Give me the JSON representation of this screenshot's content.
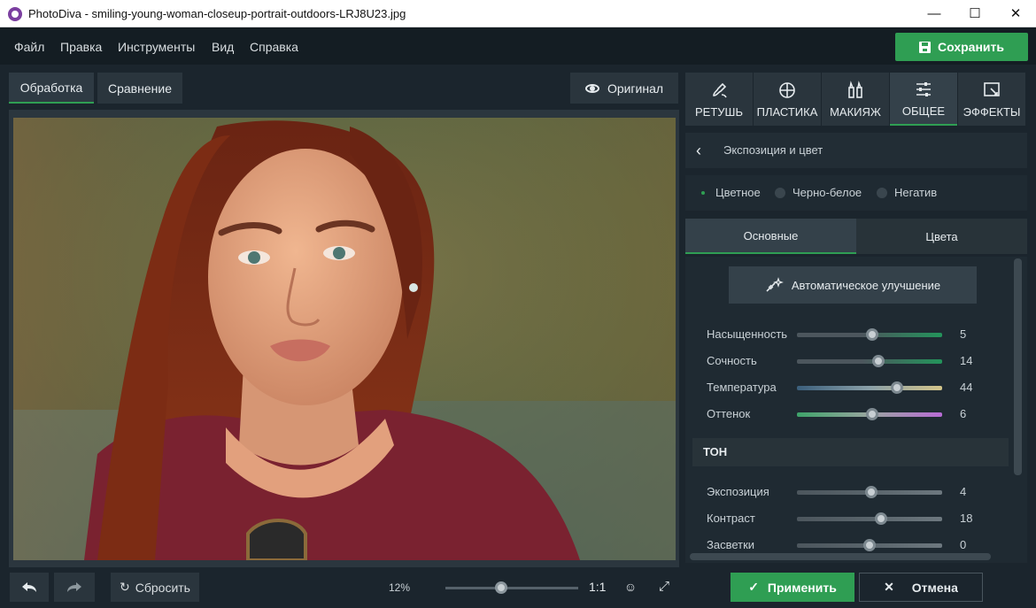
{
  "window": {
    "title": "PhotoDiva - smiling-young-woman-closeup-portrait-outdoors-LRJ8U23.jpg",
    "minimize": "—",
    "maximize": "☐",
    "close": "✕"
  },
  "menu": {
    "items": [
      "Файл",
      "Правка",
      "Инструменты",
      "Вид",
      "Справка"
    ],
    "save_label": "Сохранить"
  },
  "view_tabs": {
    "process": "Обработка",
    "compare": "Сравнение",
    "original": "Оригинал"
  },
  "tool_tabs": [
    {
      "label": "РЕТУШЬ",
      "icon": "retouch-brush-icon"
    },
    {
      "label": "ПЛАСТИКА",
      "icon": "crosshair-icon"
    },
    {
      "label": "МАКИЯЖ",
      "icon": "makeup-icon"
    },
    {
      "label": "ОБЩЕЕ",
      "icon": "sliders-icon",
      "active": true
    },
    {
      "label": "ЭФФЕКТЫ",
      "icon": "effects-icon"
    }
  ],
  "section": {
    "title": "Экспозиция и цвет"
  },
  "color_modes": {
    "color": "Цветное",
    "bw": "Черно-белое",
    "negative": "Негатив",
    "selected": "Цветное"
  },
  "sub_tabs": {
    "basic": "Основные",
    "colors": "Цвета"
  },
  "auto_enhance_label": "Автоматическое улучшение",
  "color_sliders": [
    {
      "label": "Насыщенность",
      "value": "5",
      "position": 0.52
    },
    {
      "label": "Сочность",
      "value": "14",
      "position": 0.56
    },
    {
      "label": "Температура",
      "value": "44",
      "position": 0.69
    },
    {
      "label": "Оттенок",
      "value": "6",
      "position": 0.52
    }
  ],
  "tone": {
    "heading": "ТОН",
    "sliders": [
      {
        "label": "Экспозиция",
        "value": "4",
        "position": 0.51
      },
      {
        "label": "Контраст",
        "value": "18",
        "position": 0.58
      },
      {
        "label": "Засветки",
        "value": "0",
        "position": 0.5
      }
    ]
  },
  "bottom": {
    "reset_label": "Сбросить",
    "zoom_percent": "12%",
    "zoom_position": 0.42,
    "one_to_one": "1:1",
    "apply_label": "Применить",
    "cancel_label": "Отмена"
  },
  "colors": {
    "accent": "#2f9e53",
    "panel": "#1f2a32"
  }
}
